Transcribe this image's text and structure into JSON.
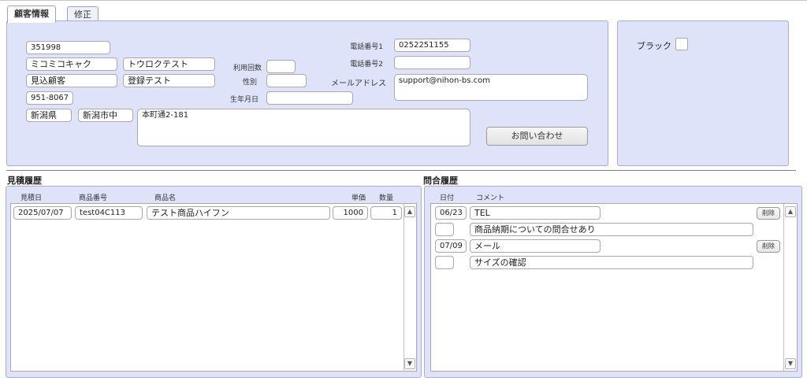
{
  "tabs": [
    {
      "label": "顧客情報"
    },
    {
      "label": "修正"
    }
  ],
  "customer": {
    "id": "351998",
    "name_kana_1": "ミコミコキャク",
    "name_kana_2": "トウロクテスト",
    "name_1": "見込顧客",
    "name_2": "登録テスト",
    "postal": "951-8067",
    "prefecture": "新潟県",
    "city": "新潟市中",
    "address": "本町通2-181",
    "usage_label": "利用回数",
    "usage_value": "",
    "gender_label": "性別",
    "gender_value": "",
    "birth_label": "生年月日",
    "birth_value": "",
    "phone1_label": "電話番号1",
    "phone1_value": "0252251155",
    "phone2_label": "電話番号2",
    "phone2_value": "",
    "email_label": "メールアドレス",
    "email_value": "support@nihon-bs.com",
    "inquiry_button": "お問い合わせ"
  },
  "blacklist": {
    "label": "ブラック",
    "checked": false
  },
  "quotes": {
    "title": "見積履歴",
    "headers": {
      "date": "見積日",
      "product_no": "商品番号",
      "product_name": "商品名",
      "price": "単価",
      "qty": "数量"
    },
    "rows": [
      {
        "date": "2025/07/07",
        "product_no": "test04C113",
        "product_name": "テスト商品ハイフン",
        "price": "1000",
        "qty": "1"
      }
    ]
  },
  "inquiries": {
    "title": "問合履歴",
    "headers": {
      "date": "日付",
      "comment": "コメント"
    },
    "delete_label": "削除",
    "rows": [
      {
        "date": "06/23",
        "type": "TEL",
        "detail": "商品納期についての問合せあり"
      },
      {
        "date": "07/09",
        "type": "メール",
        "detail": "サイズの確認"
      }
    ]
  }
}
